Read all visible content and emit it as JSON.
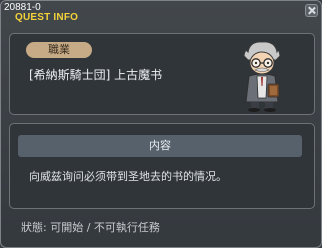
{
  "header": {
    "quest_id": "20881-0",
    "title": "QUEST INFO"
  },
  "job_panel": {
    "badge_label": "職業",
    "job_name": "[希納斯騎士団] 上古魔书",
    "npc_icon": "old-scholar-npc-icon"
  },
  "content_panel": {
    "header_label": "内容",
    "description": "向威兹询问必须带到圣地去的书的情况。"
  },
  "status": {
    "text": "狀態: 可開始 / 不可執行任務"
  },
  "colors": {
    "title": "#f4d23a",
    "badge_bg": "#c7ab86",
    "window_bg": "#3a3f44"
  }
}
